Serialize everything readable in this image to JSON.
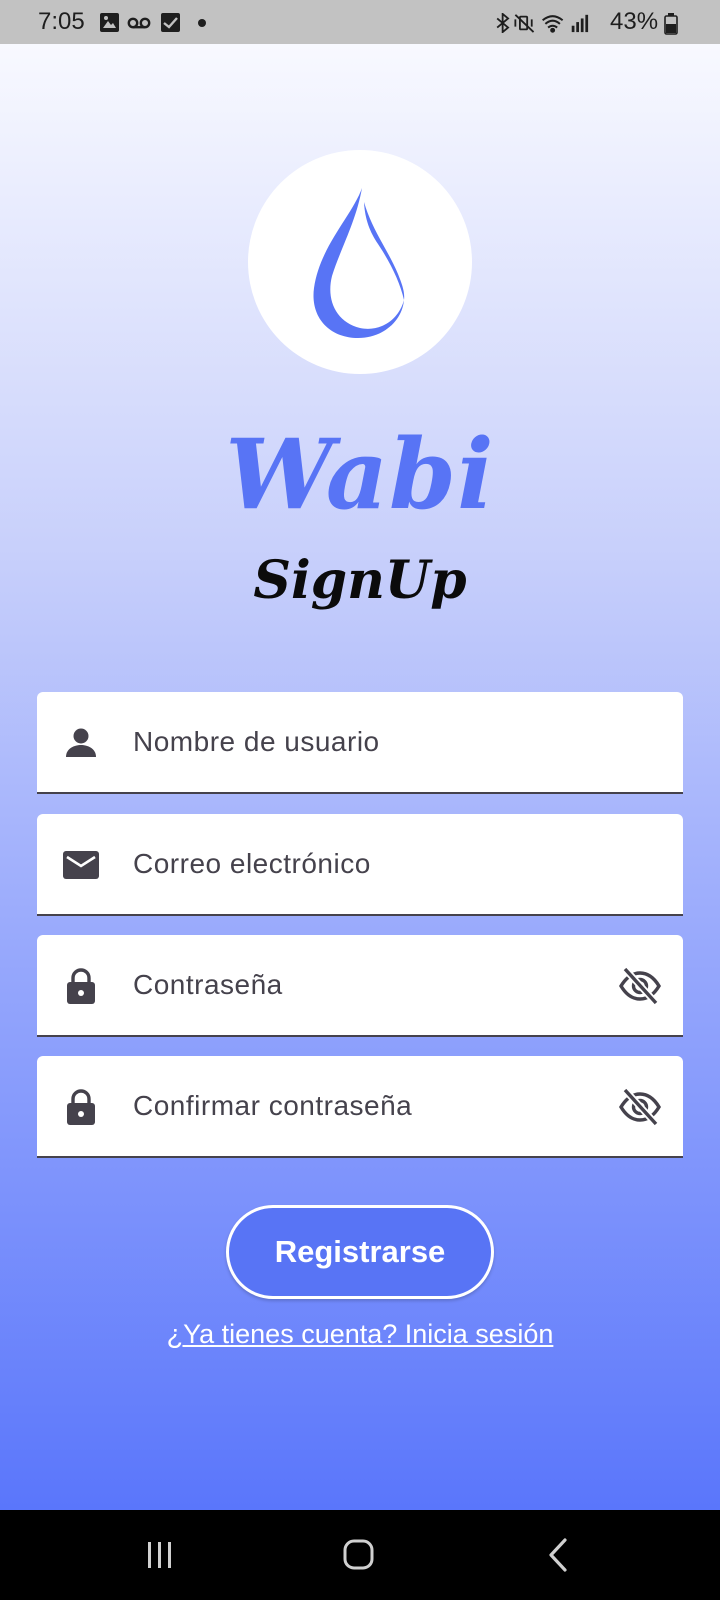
{
  "status_bar": {
    "time": "7:05",
    "battery_percent": "43%",
    "icons_left": [
      "image-icon",
      "voicemail-icon",
      "checkbox-icon",
      "dot-icon"
    ],
    "icons_right": [
      "bluetooth-icon",
      "vibrate-mute-icon",
      "wifi-icon",
      "signal-icon",
      "battery-icon"
    ]
  },
  "app": {
    "logo_icon": "water-drop-icon",
    "title": "Wabi",
    "subtitle": "SignUp"
  },
  "form": {
    "username": {
      "placeholder": "Nombre de usuario",
      "value": "",
      "icon": "person-icon"
    },
    "email": {
      "placeholder": "Correo electrónico",
      "value": "",
      "icon": "mail-icon"
    },
    "password": {
      "placeholder": "Contraseña",
      "value": "",
      "icon": "lock-icon",
      "toggle_icon": "eye-off-icon"
    },
    "confirm_password": {
      "placeholder": "Confirmar contraseña",
      "value": "",
      "icon": "lock-icon",
      "toggle_icon": "eye-off-icon"
    },
    "submit_label": "Registrarse",
    "login_link": "¿Ya tienes cuenta? Inicia sesión"
  },
  "nav_bar": {
    "buttons": [
      "recents-icon",
      "home-icon",
      "back-icon"
    ]
  },
  "colors": {
    "brand": "#5874F5",
    "gradient_top": "#F8F9FF",
    "gradient_bottom": "#5A76FB",
    "field_text": "#45424C"
  }
}
